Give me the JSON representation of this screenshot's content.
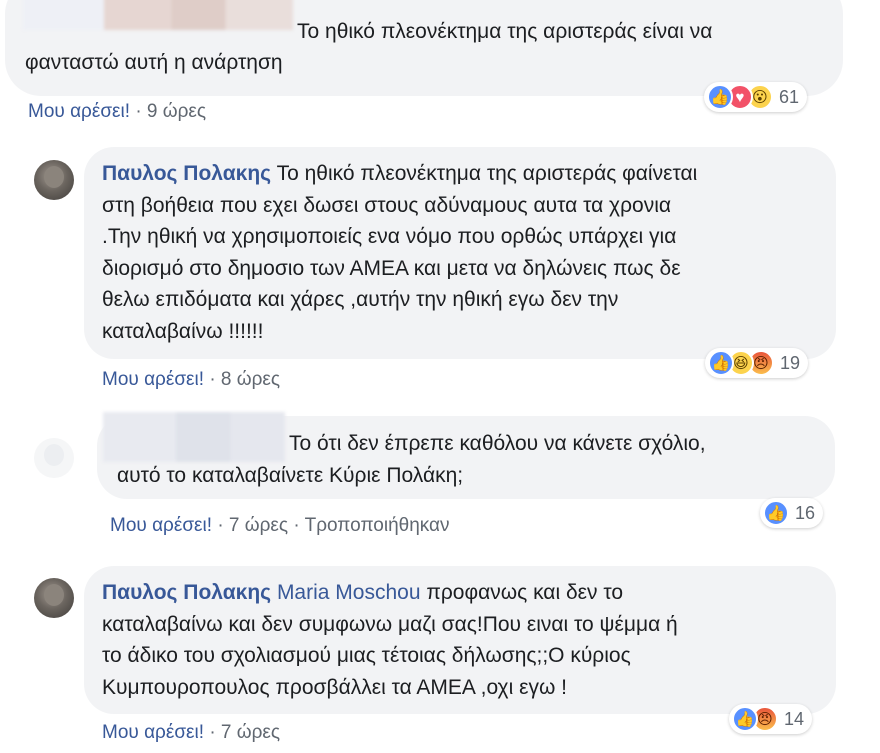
{
  "comments": [
    {
      "text": "Το ηθικό πλεονέκτημα της αριστεράς είναι να φανταστώ αυτή η ανάρτηση",
      "line1": "Το ηθικό πλεονέκτημα της αριστεράς είναι να",
      "line2": "φανταστώ αυτή η ανάρτηση",
      "like_label": "Μου αρέσει!",
      "sep": "·",
      "time": "9 ώρες",
      "reaction_count": "61",
      "reactions": [
        "like",
        "love",
        "wow"
      ]
    },
    {
      "author": "Παυλος Πολακης",
      "lines": [
        "Το ηθικό πλεονέκτημα της αριστεράς φαίνεται",
        "στη βοήθεια που εχει δωσει στους αδύναμους αυτα τα χρονια",
        ".Την ηθική να χρησιμοποιείς ενα νόμο που ορθώς υπάρχει για",
        "διορισμό στο δημοσιο των ΑΜΕΑ και μετα να δηλώνεις πως δε",
        "θελω επιδόματα και χάρες ,αυτήν την ηθική εγω δεν την",
        "καταλαβαίνω !!!!!!"
      ],
      "like_label": "Μου αρέσει!",
      "sep": "·",
      "time": "8 ώρες",
      "reaction_count": "19",
      "reactions": [
        "like",
        "haha",
        "angry"
      ]
    },
    {
      "line1": "Το ότι δεν έπρεπε καθόλου να κάνετε σχόλιο,",
      "line2": "αυτό το καταλαβαίνετε Κύριε Πολάκη;",
      "like_label": "Μου αρέσει!",
      "sep": "·",
      "time": "7 ώρες",
      "edited": "Τροποποιήθηκαν",
      "reaction_count": "16",
      "reactions": [
        "like"
      ]
    },
    {
      "author": "Παυλος Πολακης",
      "mention": "Maria Moschou",
      "lines": [
        "προφανως και δεν το",
        "καταλαβαίνω και δεν συμφωνω μαζι σας!Που ειναι το ψέμμα ή",
        "το άδικο του σχολιασμού μιας τέτοιας δήλωσης;;Ο κύριος",
        "Κυμπουροπουλος προσβάλλει τα ΑΜΕΑ ,οχι εγω !"
      ],
      "like_label": "Μου αρέσει!",
      "sep": "·",
      "time": "7 ώρες",
      "reaction_count": "14",
      "reactions": [
        "like",
        "angry"
      ]
    }
  ],
  "icons": {
    "like": "👍",
    "love": "♥",
    "wow": "😮",
    "haha": "😆",
    "angry": "😠"
  },
  "colors": {
    "link": "#385898",
    "bubble": "#f2f3f5",
    "meta": "#606770",
    "like_blue": "#5890ff",
    "love_red": "#f25268"
  }
}
